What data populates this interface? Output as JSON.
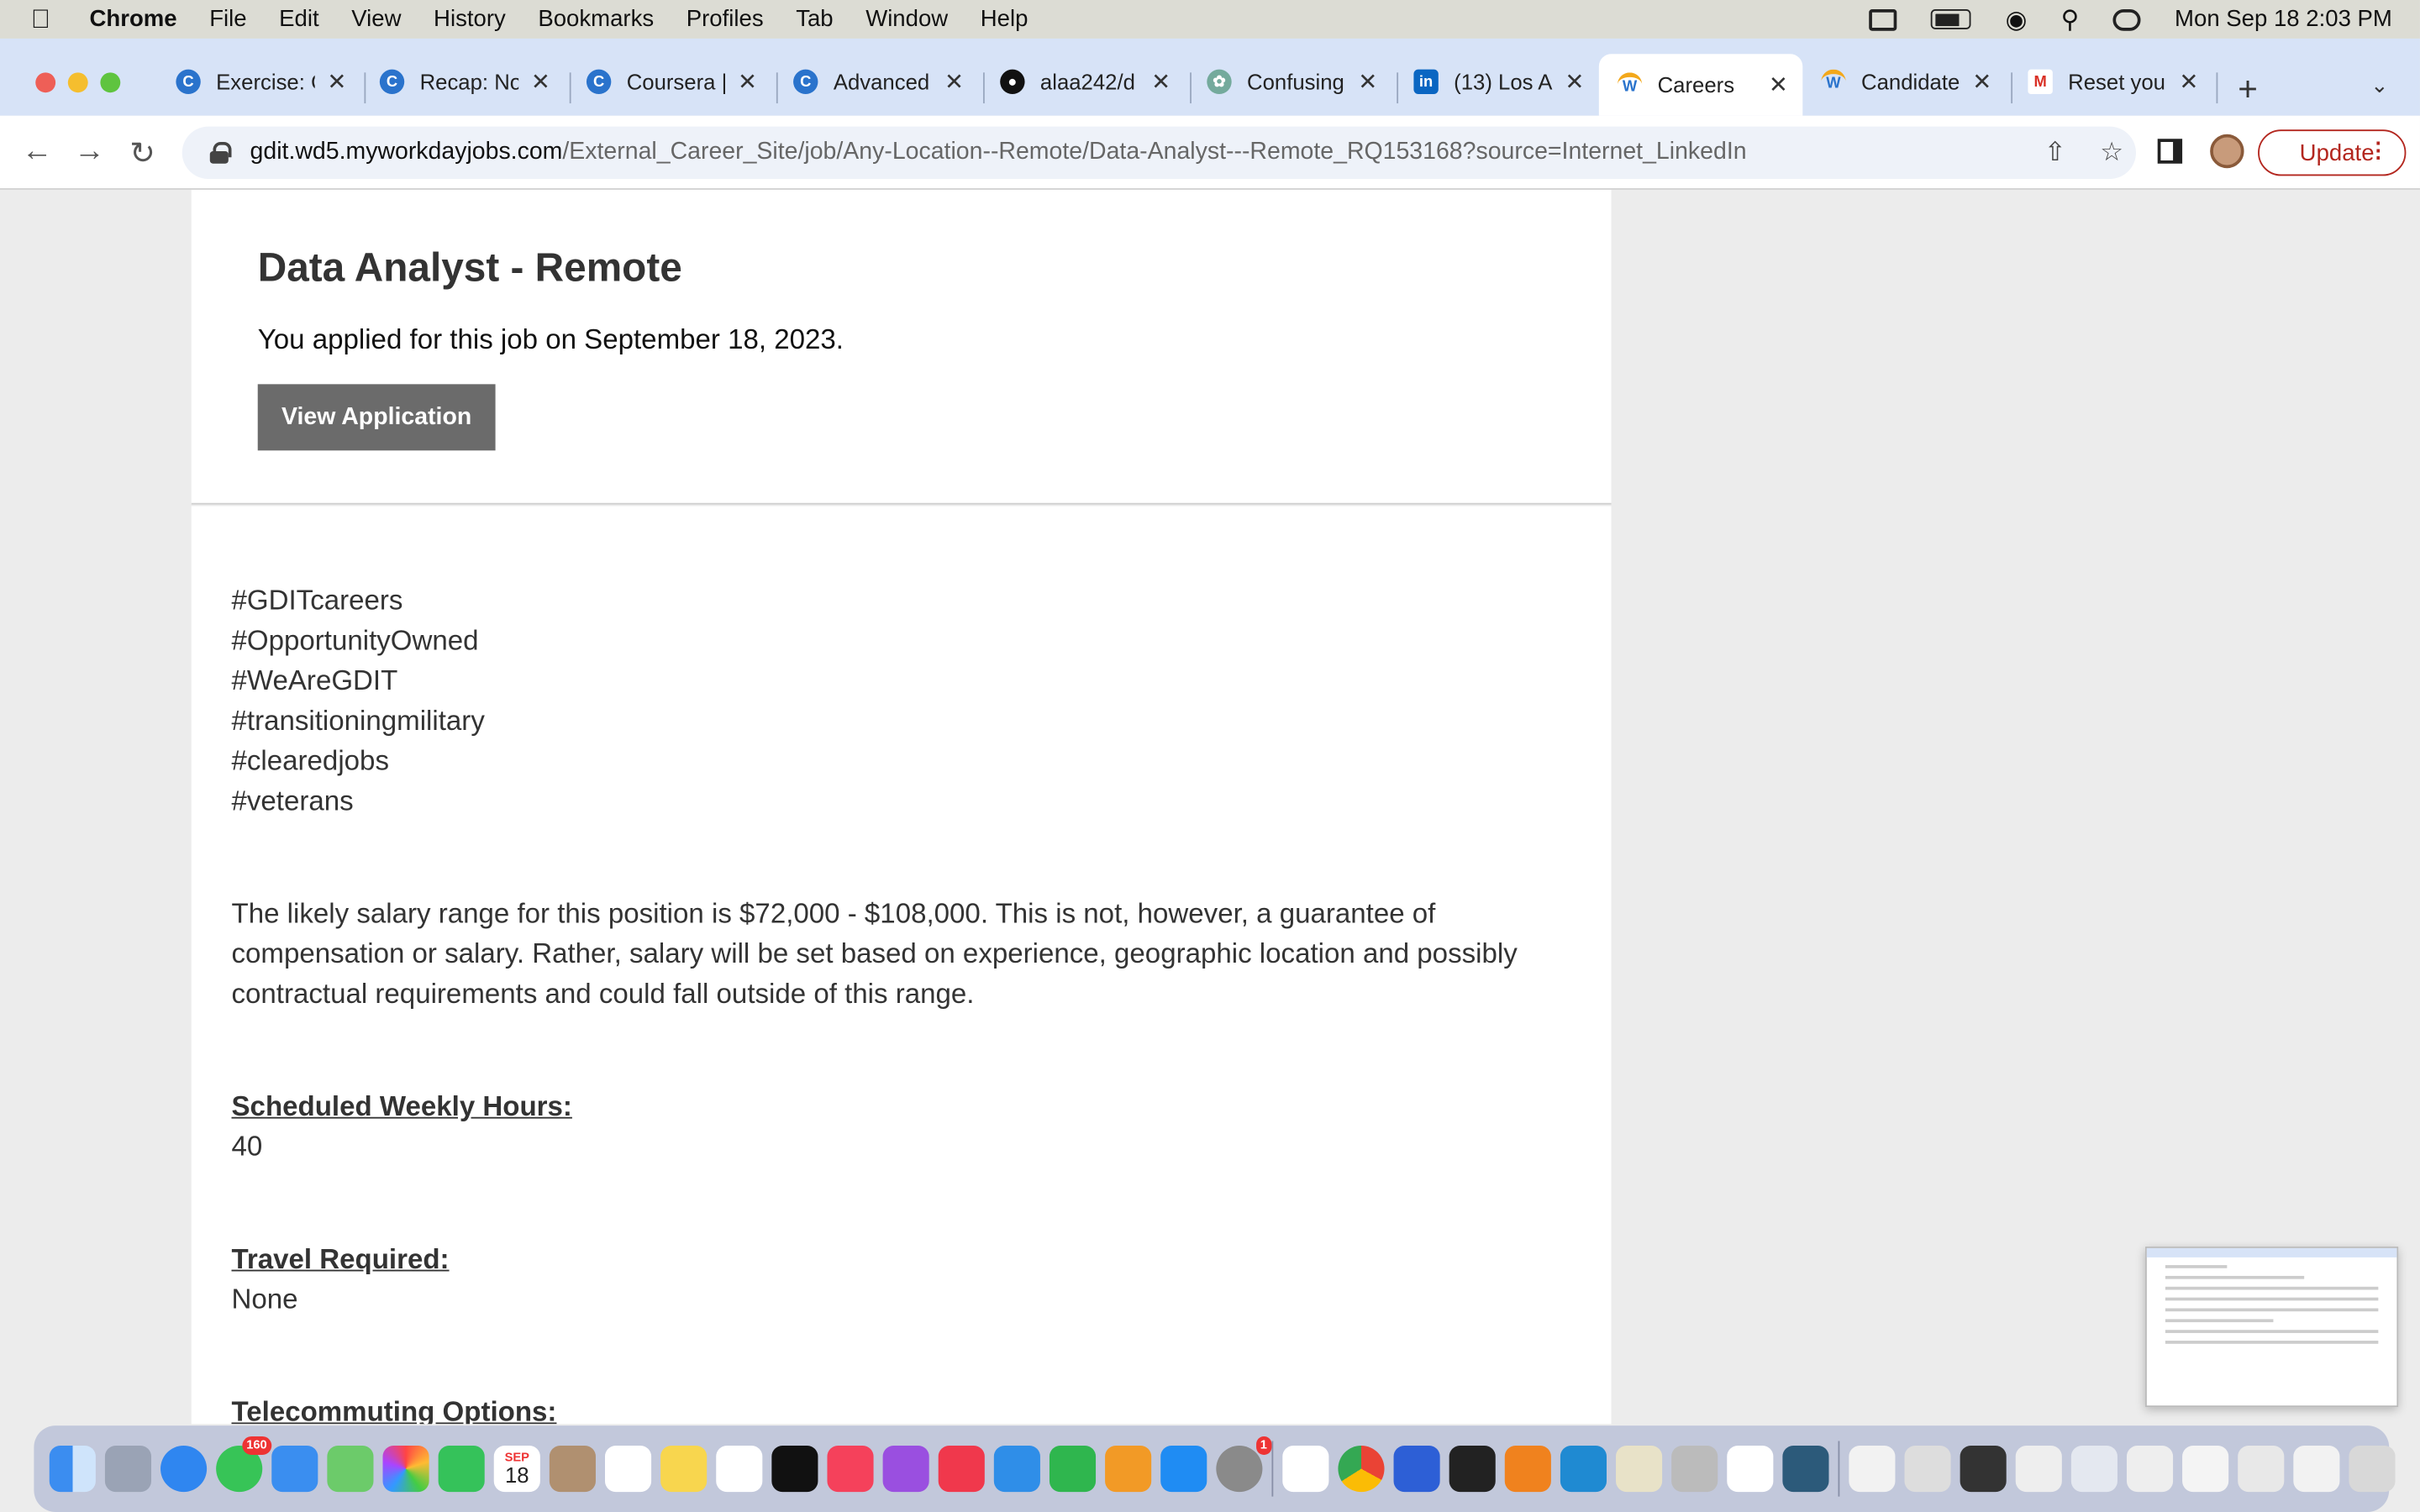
{
  "menubar": {
    "app": "Chrome",
    "items": [
      "File",
      "Edit",
      "View",
      "History",
      "Bookmarks",
      "Profiles",
      "Tab",
      "Window",
      "Help"
    ],
    "datetime": "Mon Sep 18  2:03 PM"
  },
  "tabs": [
    {
      "title": "Exercise: C",
      "icon": "coursera-icon",
      "color": "#2a73cc",
      "active": false
    },
    {
      "title": "Recap: No",
      "icon": "coursera-icon",
      "color": "#2a73cc",
      "active": false
    },
    {
      "title": "Coursera |",
      "icon": "coursera-icon",
      "color": "#2a73cc",
      "active": false
    },
    {
      "title": "Advanced",
      "icon": "coursera-icon",
      "color": "#2a73cc",
      "active": false
    },
    {
      "title": "alaa242/d",
      "icon": "github-icon",
      "color": "#111111",
      "active": false
    },
    {
      "title": "Confusing",
      "icon": "openai-icon",
      "color": "#74aa9c",
      "active": false
    },
    {
      "title": "(13) Los A",
      "icon": "linkedin-icon",
      "color": "#0a66c2",
      "active": false
    },
    {
      "title": "Careers",
      "icon": "workday-icon",
      "color": "#f3a81b",
      "active": true
    },
    {
      "title": "Candidate",
      "icon": "workday-icon",
      "color": "#f3a81b",
      "active": false
    },
    {
      "title": "Reset you",
      "icon": "gmail-icon",
      "color": "#d93025",
      "active": false
    }
  ],
  "address": {
    "host": "gdit.wd5.myworkdayjobs.com",
    "path": "/External_Career_Site/job/Any-Location--Remote/Data-Analyst---Remote_RQ153168?source=Internet_LinkedIn"
  },
  "toolbar": {
    "update_label": "Update"
  },
  "job": {
    "title": "Data Analyst - Remote",
    "applied": "You applied for this job on September 18, 2023.",
    "view_button": "View Application"
  },
  "body": {
    "tags": [
      "#GDITcareers",
      "#OpportunityOwned",
      "#WeAreGDIT",
      "#transitioningmilitary",
      "#clearedjobs",
      "#veterans"
    ],
    "salary": "The likely salary range for this position is $72,000 - $108,000. This is not, however, a guarantee of compensation or salary. Rather, salary will be set based on experience, geographic location and possibly contractual requirements and could fall outside of this range.",
    "hours_label": "Scheduled Weekly Hours:",
    "hours_value": "40",
    "travel_label": "Travel Required:",
    "travel_value": "None",
    "telecommute_label": "Telecommuting Options:"
  },
  "dock": {
    "messages_badge": "160",
    "calendar_month": "SEP",
    "calendar_day": "18",
    "settings_badge": "1"
  },
  "colors": {
    "tabstrip": "#d7e3f7",
    "update": "#b3261e",
    "button": "#6b6b6b"
  }
}
